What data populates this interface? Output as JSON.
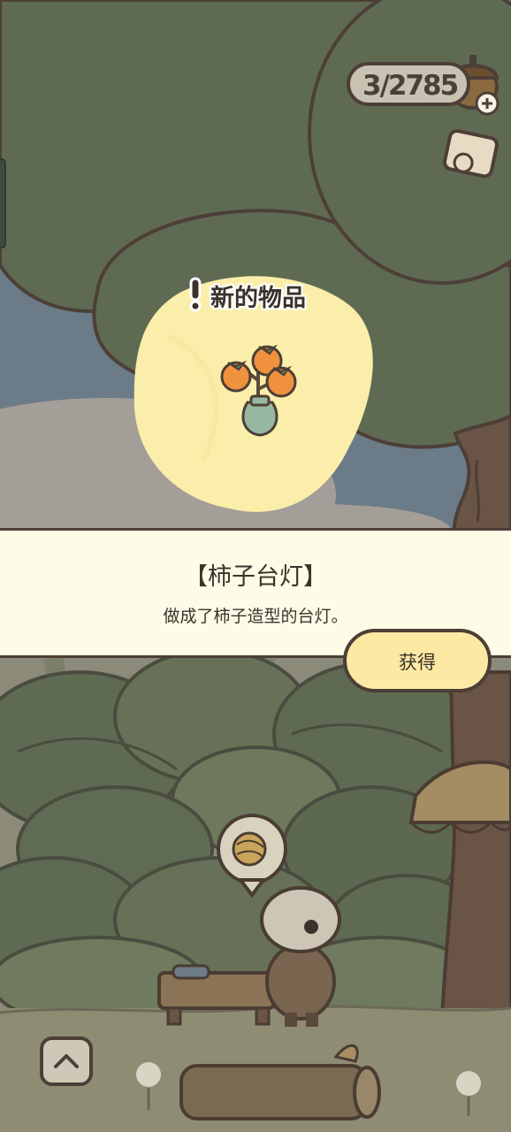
{
  "hud": {
    "acorn_count": "3/2785",
    "acorn_icon": "acorn-icon",
    "plus_icon": "plus-icon",
    "ticket_icon": "ticket-icon"
  },
  "popup": {
    "header": "新的物品",
    "item_icon": "persimmon-lamp-icon",
    "item_name": "【柿子台灯】",
    "item_desc": "做成了柿子造型的台灯。",
    "obtain_label": "获得"
  },
  "bottom": {
    "up_icon": "chevron-up-icon",
    "thought_bubble_icon": "yarn-ball-icon"
  },
  "colors": {
    "banner_bg": "#fefbe6",
    "button_bg": "#fde9a3",
    "outline": "#4c3f37",
    "glow": "#fbeeaa"
  }
}
